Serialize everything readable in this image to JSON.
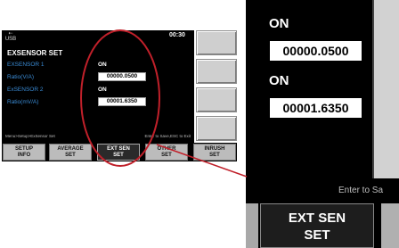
{
  "status_bar": {
    "usb_label": "USB",
    "time": "00:30"
  },
  "page": {
    "title": "EXSENSOR SET"
  },
  "sensor1": {
    "label": "EXSENSOR 1",
    "state": "ON",
    "ratio_label": "Ratio(V/A)",
    "ratio_value": "00000.0500"
  },
  "sensor2": {
    "label": "ExSENSOR 2",
    "state": "ON",
    "ratio_label": "Ratio(mV/A)",
    "ratio_value": "00001.6350"
  },
  "status": {
    "path": "Menu>Setup>ExSensor Set",
    "hint": "Enter to Save,ESC to Exit"
  },
  "fkeys": [
    {
      "line1": "SETUP",
      "line2": "INFO"
    },
    {
      "line1": "AVERAGE",
      "line2": "SET"
    },
    {
      "line1": "EXT SEN",
      "line2": "SET"
    },
    {
      "line1": "OTHER",
      "line2": "SET"
    },
    {
      "line1": "INRUSH",
      "line2": "SET"
    }
  ],
  "zoom": {
    "state1": "ON",
    "value1": "00000.0500",
    "state2": "ON",
    "value2": "00001.6350",
    "hint": "Enter to Sa",
    "button_line1": "EXT SEN",
    "button_line2": "SET"
  },
  "colors": {
    "label_blue": "#3a8cd6",
    "highlight_red": "#c0202a",
    "screen_bg": "#000000"
  }
}
